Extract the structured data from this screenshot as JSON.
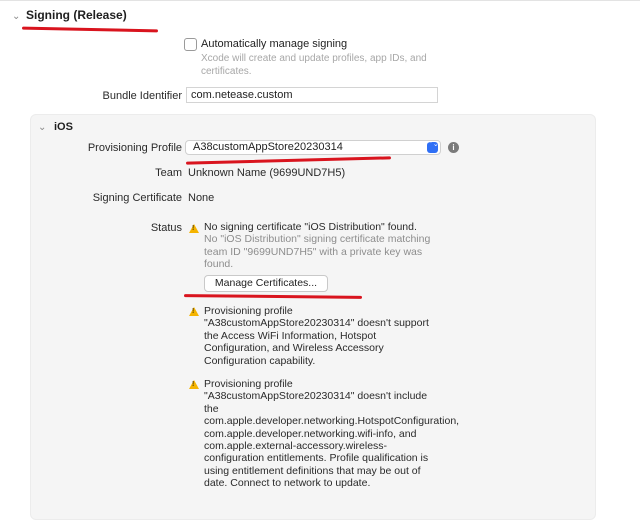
{
  "section": {
    "chevron": "⌄",
    "title": "Signing (Release)"
  },
  "auto_manage": {
    "label": "Automatically manage signing",
    "description": "Xcode will create and update profiles, app IDs, and certificates.",
    "checked": false
  },
  "bundle": {
    "label": "Bundle Identifier",
    "value": "com.netease.custom"
  },
  "ios": {
    "chevron": "⌄",
    "title": "iOS",
    "provisioning_label": "Provisioning Profile",
    "provisioning_value": "A38customAppStore20230314",
    "team_label": "Team",
    "team_value": "Unknown Name (9699UND7H5)",
    "cert_label": "Signing Certificate",
    "cert_value": "None",
    "status_label": "Status",
    "status_main": "No signing certificate \"iOS Distribution\" found.",
    "status_sub": "No \"iOS Distribution\" signing certificate matching team ID \"9699UND7H5\" with a private key was found.",
    "manage_button": "Manage Certificates...",
    "warning_2": "Provisioning profile \"A38customAppStore20230314\" doesn't support the Access WiFi Information, Hotspot Configuration, and Wireless Accessory Configuration capability.",
    "warning_3": "Provisioning profile \"A38customAppStore20230314\" doesn't include the com.apple.developer.networking.HotspotConfiguration, com.apple.developer.networking.wifi-info, and com.apple.external-accessory.wireless-configuration entitlements. Profile qualification is using entitlement definitions that may be out of date. Connect to network to update."
  },
  "icons": {
    "info": "i",
    "warning": "!",
    "popup_arrows": "⌃⌄"
  },
  "colors": {
    "accent": "#2f6ff5",
    "warning": "#f5b400",
    "annotation": "#d9141e"
  }
}
